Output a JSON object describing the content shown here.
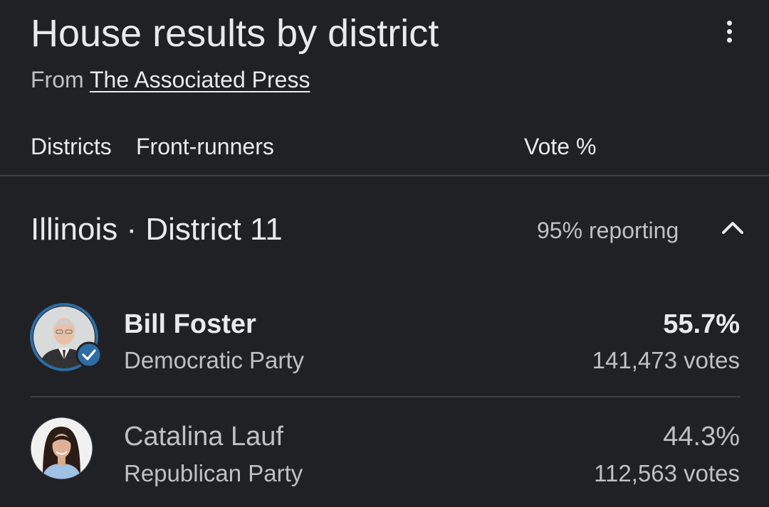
{
  "card": {
    "title": "House results by district",
    "source_prefix": "From",
    "source_link": "The Associated Press"
  },
  "columns": {
    "districts": "Districts",
    "front_runners": "Front-runners",
    "vote_pct": "Vote %"
  },
  "race": {
    "district": "Illinois · District 11",
    "reporting": "95% reporting",
    "expanded": true
  },
  "candidates": [
    {
      "name": "Bill Foster",
      "party": "Democratic Party",
      "percent": "55.7%",
      "votes": "141,473 votes",
      "winner": true,
      "avatar_icon": "person-photo-icon",
      "party_color": "#2e6da4"
    },
    {
      "name": "Catalina Lauf",
      "party": "Republican Party",
      "percent": "44.3%",
      "votes": "112,563 votes",
      "winner": false,
      "avatar_icon": "person-photo-icon",
      "party_color": "#5f6368"
    }
  ],
  "colors": {
    "background": "#202124",
    "text_primary": "#e8eaed",
    "text_secondary": "#bdc1c6",
    "divider": "#3c4043",
    "winner_check": "#2e6da4"
  }
}
